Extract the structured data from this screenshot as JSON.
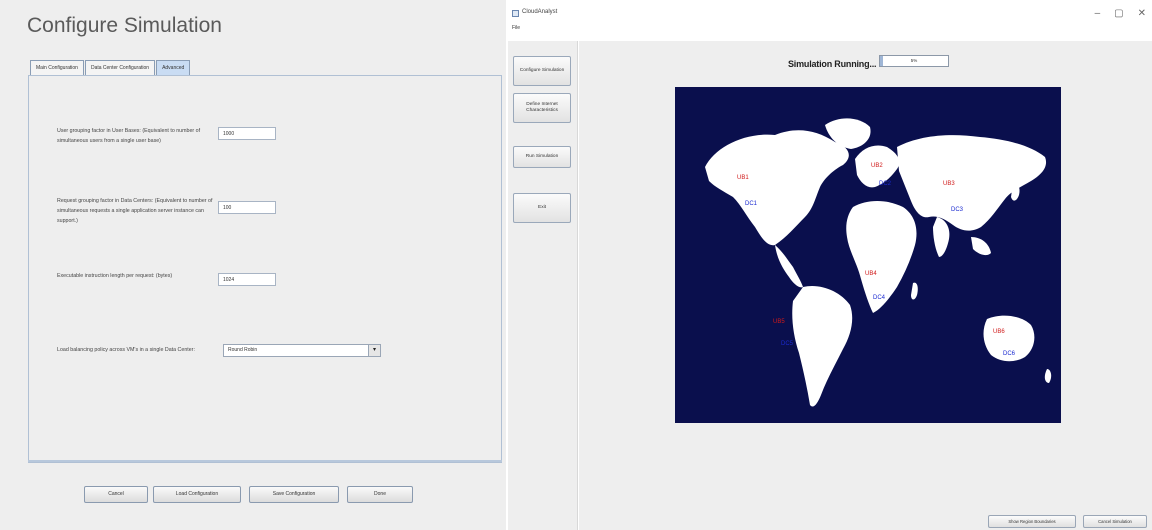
{
  "config": {
    "title": "Configure Simulation",
    "tabs": [
      "Main Configuration",
      "Data Center Configuration",
      "Advanced"
    ],
    "fields": [
      {
        "label": "User grouping factor in User Bases: (Equivalent to number of simultaneous users from a single user base)",
        "value": "1000"
      },
      {
        "label": "Request grouping factor in Data Centers: (Equivalent to number of simultaneous requests a single application server instance can support.)",
        "value": "100"
      },
      {
        "label": "Executable instruction length per request: (bytes)",
        "value": "1024"
      }
    ],
    "load_balancing": {
      "label": "Load balancing policy across VM's in a single Data Center:",
      "value": "Round Robin"
    },
    "buttons": {
      "cancel": "Cancel",
      "load": "Load Configuration",
      "save": "Save Configuration",
      "done": "Done"
    }
  },
  "window": {
    "title": "CloudAnalyst",
    "menu": "File",
    "controls": {
      "minimize": "–",
      "maximize": "▢",
      "close": "✕"
    }
  },
  "sidebar": {
    "items": [
      "Configure Simulation",
      "Define Internet Characteristics",
      "Run Simulation",
      "Exit"
    ]
  },
  "simulation": {
    "status_label": "Simulation Running...",
    "progress_text": "5%",
    "progress_fraction": 0.05
  },
  "map": {
    "background_color": "#0a0f4d",
    "land_color": "#ffffff",
    "markers": [
      {
        "user_base": "UB1",
        "data_center": "DC1"
      },
      {
        "user_base": "UB2",
        "data_center": "DC2"
      },
      {
        "user_base": "UB3",
        "data_center": "DC3"
      },
      {
        "user_base": "UB4",
        "data_center": "DC4"
      },
      {
        "user_base": "UB5",
        "data_center": "DC5"
      },
      {
        "user_base": "UB6",
        "data_center": "DC6"
      }
    ]
  },
  "bottom_buttons": {
    "show_region_boundaries": "Show Region Boundaries",
    "cancel_simulation": "Cancel Simulation"
  }
}
